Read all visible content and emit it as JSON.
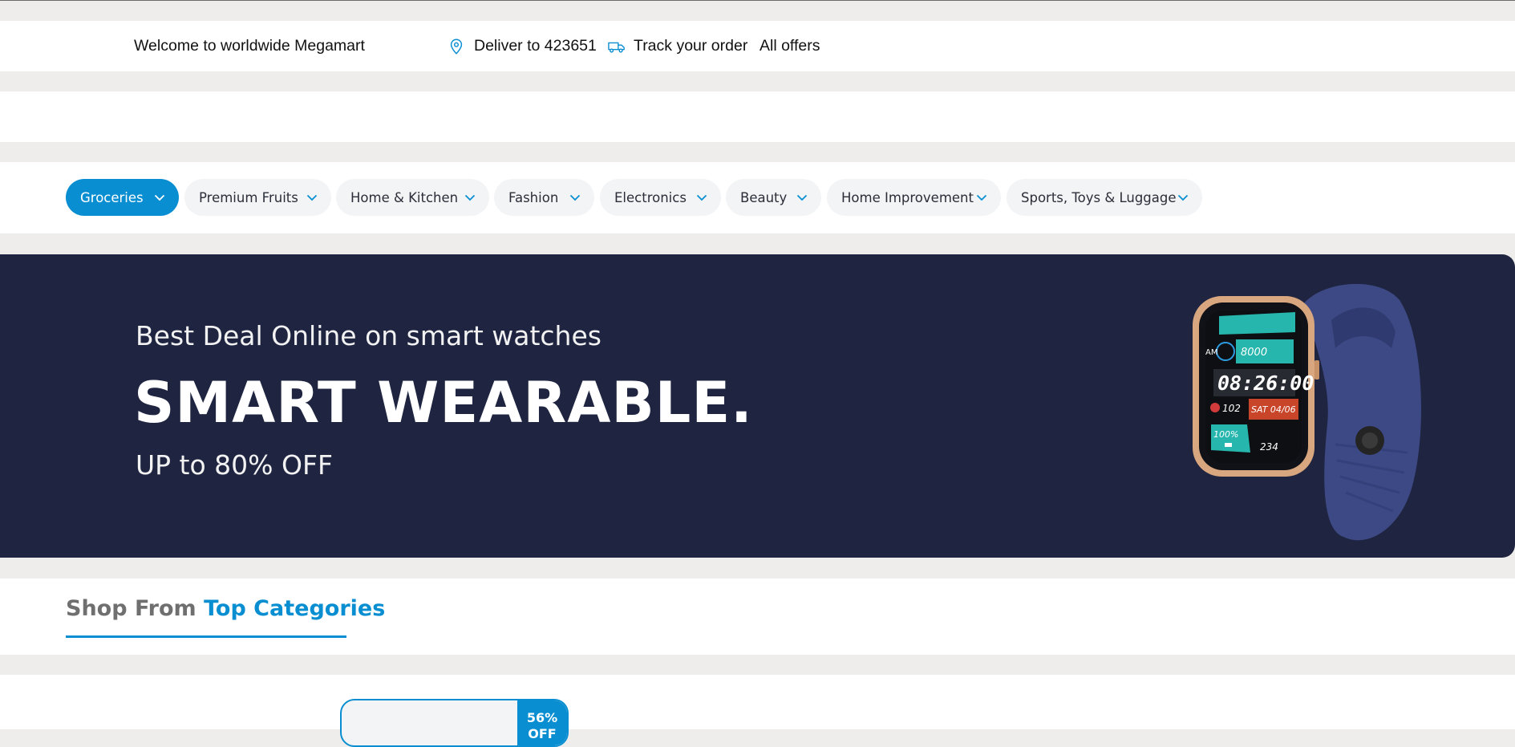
{
  "topbar": {
    "welcome": "Welcome to worldwide Megamart",
    "deliver": "Deliver to 423651",
    "track": "Track your order",
    "offers": "All offers",
    "icons": [
      "location-pin-icon",
      "truck-icon"
    ]
  },
  "nav": {
    "categories": [
      {
        "label": "Groceries",
        "active": true
      },
      {
        "label": "Premium Fruits"
      },
      {
        "label": "Home & Kitchen"
      },
      {
        "label": "Fashion"
      },
      {
        "label": "Electronics"
      },
      {
        "label": "Beauty"
      },
      {
        "label": "Home Improvement"
      },
      {
        "label": "Sports, Toys & Luggage"
      }
    ]
  },
  "hero": {
    "subtitle": "Best Deal Online on smart watches",
    "title": "SMART WEARABLE.",
    "offer": "UP to 80% OFF",
    "watch": {
      "time": "08:26:00",
      "steps": "8000",
      "ampm": "AM",
      "heart": "102",
      "date": "SAT 04/06",
      "battery": "100%",
      "calories": "234"
    }
  },
  "section": {
    "title_prefix": "Shop From",
    "title_highlight": "Top Categories"
  },
  "product": {
    "discount_pct": "56%",
    "discount_label": "OFF"
  },
  "colors": {
    "accent": "#0a8ed2",
    "banner_bg": "#1f2541",
    "page_bg": "#eeedeb"
  }
}
